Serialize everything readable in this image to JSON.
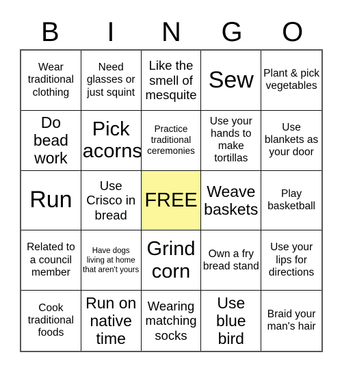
{
  "header": {
    "letters": [
      "B",
      "I",
      "N",
      "G",
      "O"
    ]
  },
  "colors": {
    "free_space_background": "#fbf79a",
    "grid_border": "#555555",
    "cell_border": "#111111",
    "page_background": "#ffffff",
    "text": "#000000"
  },
  "grid": {
    "columns": 5,
    "rows": 5,
    "cells": [
      {
        "text": "Wear traditional clothing",
        "size": "md",
        "free": false
      },
      {
        "text": "Need glasses or just squint",
        "size": "md",
        "free": false
      },
      {
        "text": "Like the smell of mesquite",
        "size": "lg",
        "free": false
      },
      {
        "text": "Sew",
        "size": "huge",
        "free": false
      },
      {
        "text": "Plant & pick vegetables",
        "size": "md",
        "free": false
      },
      {
        "text": "Do bead work",
        "size": "xl",
        "free": false
      },
      {
        "text": "Pick acorns",
        "size": "xxl",
        "free": false
      },
      {
        "text": "Practice traditional ceremonies",
        "size": "sm",
        "free": false
      },
      {
        "text": "Use your hands to make tortillas",
        "size": "md",
        "free": false
      },
      {
        "text": "Use blankets as your door",
        "size": "md",
        "free": false
      },
      {
        "text": "Run",
        "size": "huge",
        "free": false
      },
      {
        "text": "Use Crisco in bread",
        "size": "lg",
        "free": false
      },
      {
        "text": "FREE",
        "size": "xxl",
        "free": true
      },
      {
        "text": "Weave baskets",
        "size": "xl",
        "free": false
      },
      {
        "text": "Play basketball",
        "size": "md",
        "free": false
      },
      {
        "text": "Related to a council member",
        "size": "md",
        "free": false
      },
      {
        "text": "Have dogs living at home that aren't yours",
        "size": "xs",
        "free": false
      },
      {
        "text": "Grind corn",
        "size": "xxl",
        "free": false
      },
      {
        "text": "Own a fry bread stand",
        "size": "md",
        "free": false
      },
      {
        "text": "Use your lips for directions",
        "size": "md",
        "free": false
      },
      {
        "text": "Cook traditional foods",
        "size": "md",
        "free": false
      },
      {
        "text": "Run on native time",
        "size": "xl",
        "free": false
      },
      {
        "text": "Wearing matching socks",
        "size": "lg",
        "free": false
      },
      {
        "text": "Use blue bird",
        "size": "xl",
        "free": false
      },
      {
        "text": "Braid your man's hair",
        "size": "md",
        "free": false
      }
    ]
  }
}
